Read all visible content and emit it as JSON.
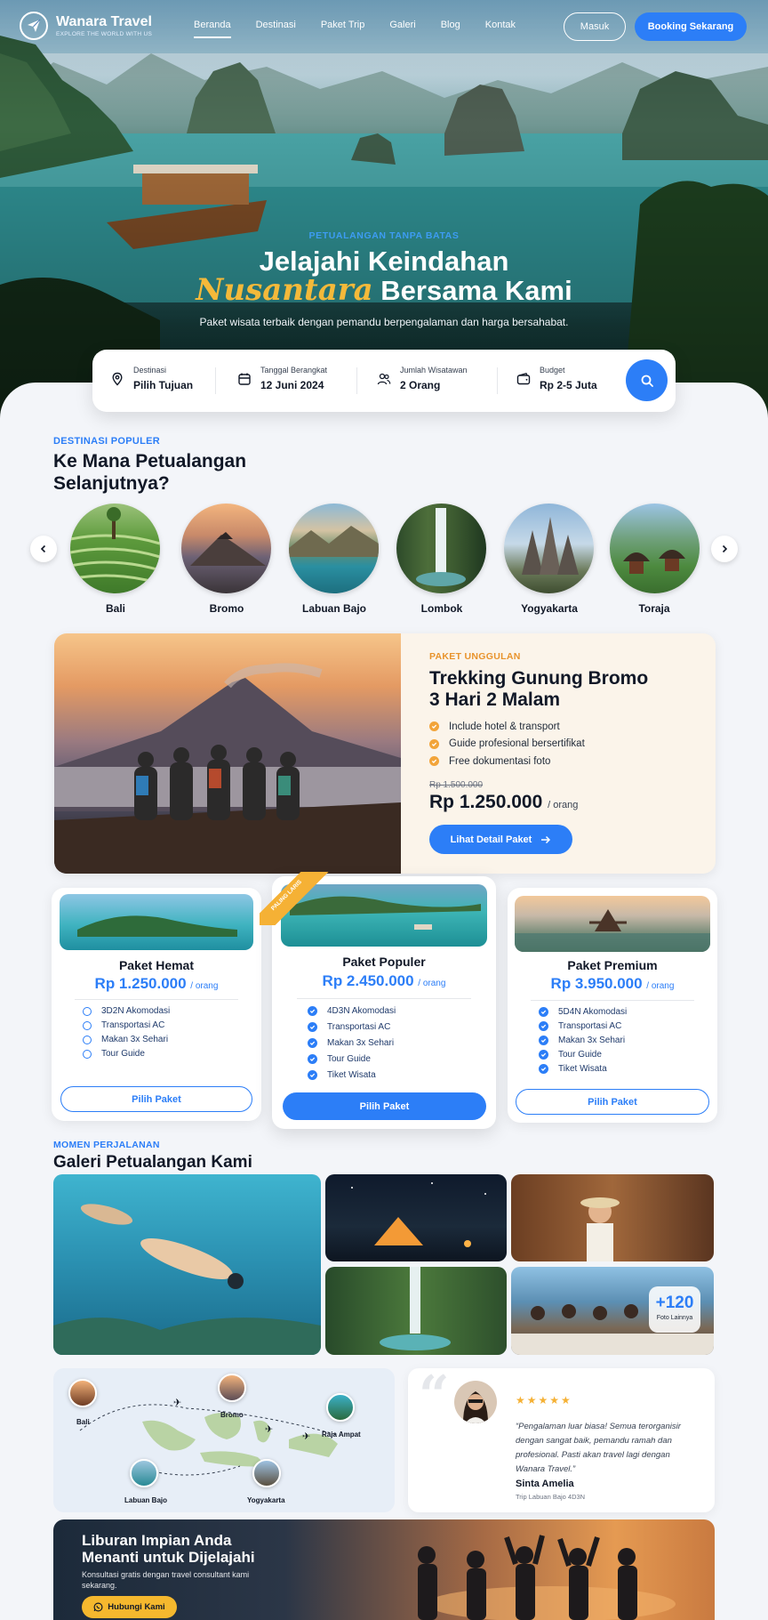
{
  "brand": {
    "name": "Wanara Travel",
    "tagline": "EXPLORE THE WORLD WITH US"
  },
  "nav": {
    "items": [
      {
        "label": "Beranda",
        "active": true
      },
      {
        "label": "Destinasi"
      },
      {
        "label": "Paket Trip"
      },
      {
        "label": "Galeri"
      },
      {
        "label": "Blog"
      },
      {
        "label": "Kontak"
      }
    ],
    "login_label": "Masuk",
    "booking_label": "Booking Sekarang"
  },
  "hero": {
    "eyebrow": "PETUALANGAN TANPA BATAS",
    "title_line1": "Jelajahi Keindahan",
    "title_script": "Nusantara",
    "title_line2_rest": " Bersama Kami",
    "subtitle": "Paket wisata terbaik dengan pemandu berpengalaman dan harga bersahabat."
  },
  "search": {
    "destination": {
      "label": "Destinasi",
      "value": "Pilih Tujuan",
      "icon": "map-pin-icon"
    },
    "date": {
      "label": "Tanggal Berangkat",
      "value": "12 Juni 2024",
      "icon": "calendar-icon"
    },
    "travelers": {
      "label": "Jumlah Wisatawan",
      "value": "2 Orang",
      "icon": "users-icon"
    },
    "budget": {
      "label": "Budget",
      "value": "Rp 2-5 Juta",
      "icon": "wallet-icon"
    },
    "button_icon": "search-icon"
  },
  "destinations": {
    "eyebrow": "DESTINASI POPULER",
    "title_line1": "Ke Mana Petualangan",
    "title_line2": "Selanjutnya?",
    "items": [
      {
        "name": "Bali"
      },
      {
        "name": "Bromo"
      },
      {
        "name": "Labuan Bajo"
      },
      {
        "name": "Lombok"
      },
      {
        "name": "Yogyakarta"
      },
      {
        "name": "Toraja"
      }
    ]
  },
  "featured": {
    "tag": "PAKET UNGGULAN",
    "title_line1": "Trekking Gunung Bromo",
    "title_line2": "3 Hari 2 Malam",
    "features": [
      "Include hotel & transport",
      "Guide profesional bersertifikat",
      "Free dokumentasi foto"
    ],
    "old_price": "Rp 1.500.000",
    "price": "Rp 1.250.000",
    "per": "/ orang",
    "button_label": "Lihat Detail Paket"
  },
  "packages": [
    {
      "name": "Paket Hemat",
      "price": "Rp 1.250.000",
      "per": "/ orang",
      "features": [
        "3D2N Akomodasi",
        "Transportasi AC",
        "Makan 3x Sehari",
        "Tour Guide"
      ],
      "button": "Pilih Paket"
    },
    {
      "name": "Paket Populer",
      "price": "Rp 2.450.000",
      "per": "/ orang",
      "ribbon": "PALING LARIS",
      "features": [
        "4D3N Akomodasi",
        "Transportasi AC",
        "Makan 3x Sehari",
        "Tour Guide",
        "Tiket Wisata"
      ],
      "button": "Pilih Paket"
    },
    {
      "name": "Paket Premium",
      "price": "Rp 3.950.000",
      "per": "/ orang",
      "features": [
        "5D4N Akomodasi",
        "Transportasi AC",
        "Makan 3x Sehari",
        "Tour Guide",
        "Tiket Wisata"
      ],
      "button": "Pilih Paket"
    }
  ],
  "gallery": {
    "eyebrow": "MOMEN PERJALANAN",
    "title": "Galeri Petualangan Kami",
    "more_count": "+120",
    "more_label": "Foto Lainnya"
  },
  "map": {
    "pins": [
      {
        "name": "Bali"
      },
      {
        "name": "Bromo"
      },
      {
        "name": "Raja Ampat"
      },
      {
        "name": "Labuan Bajo"
      },
      {
        "name": "Yogyakarta"
      }
    ]
  },
  "testimonial": {
    "stars": "★★★★★",
    "quote": "“Pengalaman luar biasa! Semua terorganisir dengan sangat baik, pemandu ramah dan profesional. Pasti akan travel lagi dengan Wanara Travel.”",
    "name": "Sinta Amelia",
    "trip": "Trip Labuan Bajo 4D3N"
  },
  "cta": {
    "title_line1": "Liburan Impian Anda",
    "title_line2": "Menanti untuk Dijelajahi",
    "subtitle": "Konsultasi gratis dengan travel consultant kami sekarang.",
    "button_label": "Hubungi Kami"
  },
  "colors": {
    "primary": "#2c7ef7",
    "accent": "#f5b135",
    "orange": "#e8932c"
  }
}
